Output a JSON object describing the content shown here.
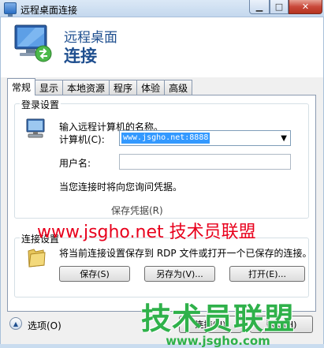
{
  "window": {
    "title": "远程桌面连接"
  },
  "header": {
    "line1": "远程桌面",
    "line2": "连接"
  },
  "tabs": [
    {
      "label": "常规",
      "active": true
    },
    {
      "label": "显示"
    },
    {
      "label": "本地资源"
    },
    {
      "label": "程序"
    },
    {
      "label": "体验"
    },
    {
      "label": "高级"
    }
  ],
  "login": {
    "group_title": "登录设置",
    "prompt": "输入远程计算机的名称。",
    "computer_label": "计算机(C):",
    "computer_value": "www.jsgho.net:8888",
    "username_label": "用户名:",
    "credential_note": "当您连接时将向您询问凭据。",
    "save_credentials_partial": "保存凭据(R)"
  },
  "connection": {
    "group_title": "连接设置",
    "description": "将当前连接设置保存到 RDP 文件或打开一个已保存的连接。",
    "save_label": "保存(S)",
    "save_as_label": "另存为(V)...",
    "open_label": "打开(E)..."
  },
  "footer": {
    "options_label": "选项(O)",
    "connect_label": "连接(N)",
    "help_label": "帮助(H)"
  },
  "watermarks": {
    "red_text": "www.jsgho.net 技术员联盟",
    "green_big": "技术员联盟",
    "green_url": "www.jsgho.com"
  },
  "colors": {
    "header_text": "#1f4f8f",
    "watermark_red": "#e8001c",
    "watermark_green": "#2fb14a",
    "selection": "#3399ff"
  }
}
